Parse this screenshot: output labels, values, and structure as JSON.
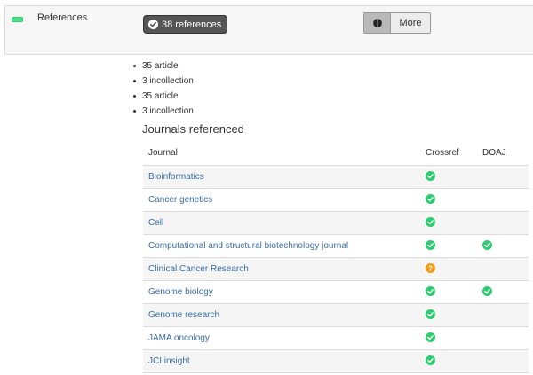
{
  "section": {
    "label": "References",
    "badge": "38 references",
    "more_label": "More"
  },
  "breakdown": [
    "35 article",
    "3 incollection",
    "35 article",
    "3 incollection"
  ],
  "journals_heading": "Journals referenced",
  "table": {
    "headers": {
      "journal": "Journal",
      "crossref": "Crossref",
      "doaj": "DOAJ"
    },
    "rows": [
      {
        "journal": "Bioinformatics",
        "crossref": "ok",
        "doaj": ""
      },
      {
        "journal": "Cancer genetics",
        "crossref": "ok",
        "doaj": ""
      },
      {
        "journal": "Cell",
        "crossref": "ok",
        "doaj": ""
      },
      {
        "journal": "Computational and structural biotechnology journal",
        "crossref": "ok",
        "doaj": "ok"
      },
      {
        "journal": "Clinical Cancer Research",
        "crossref": "warn",
        "doaj": ""
      },
      {
        "journal": "Genome biology",
        "crossref": "ok",
        "doaj": "ok"
      },
      {
        "journal": "Genome research",
        "crossref": "ok",
        "doaj": ""
      },
      {
        "journal": "JAMA oncology",
        "crossref": "ok",
        "doaj": ""
      },
      {
        "journal": "JCI insight",
        "crossref": "ok",
        "doaj": ""
      }
    ]
  },
  "colors": {
    "ok": "#2ecc71",
    "warn": "#f39c12",
    "link": "#3a6ea5",
    "badge": "#555555"
  },
  "icons": {
    "status": "battery-full-icon",
    "badge": "check-circle-icon",
    "more": "brain-icon",
    "ok": "check-circle-icon",
    "warn": "question-circle-icon"
  }
}
